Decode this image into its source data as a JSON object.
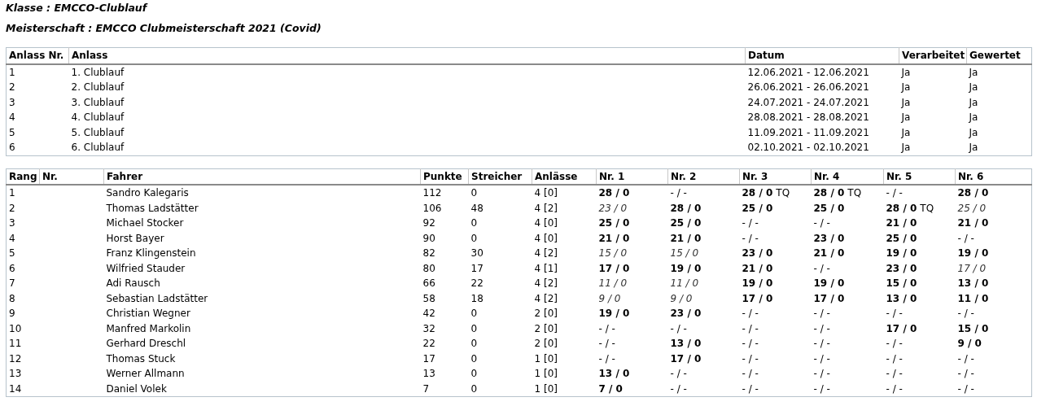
{
  "class_line": "Klasse : EMCCO-Clublauf",
  "championship_line": "Meisterschaft : EMCCO Clubmeisterschaft 2021 (Covid)",
  "events_table": {
    "columns": [
      "Anlass Nr.",
      "Anlass",
      "Datum",
      "Verarbeitet",
      "Gewertet"
    ],
    "rows": [
      [
        "1",
        "1. Clublauf",
        "12.06.2021 - 12.06.2021",
        "Ja",
        "Ja"
      ],
      [
        "2",
        "2. Clublauf",
        "26.06.2021 - 26.06.2021",
        "Ja",
        "Ja"
      ],
      [
        "3",
        "3. Clublauf",
        "24.07.2021 - 24.07.2021",
        "Ja",
        "Ja"
      ],
      [
        "4",
        "4. Clublauf",
        "28.08.2021 - 28.08.2021",
        "Ja",
        "Ja"
      ],
      [
        "5",
        "5. Clublauf",
        "11.09.2021 - 11.09.2021",
        "Ja",
        "Ja"
      ],
      [
        "6",
        "6. Clublauf",
        "02.10.2021 - 02.10.2021",
        "Ja",
        "Ja"
      ]
    ]
  },
  "ranking_table": {
    "columns": [
      "Rang",
      "Nr.",
      "Fahrer",
      "Punkte",
      "Streicher",
      "Anlässe",
      "Nr. 1",
      "Nr. 2",
      "Nr. 3",
      "Nr. 4",
      "Nr. 5",
      "Nr. 6"
    ],
    "rows": [
      {
        "rank": "1",
        "driver": "Sandro Kalegaris",
        "points": "112",
        "dropped": "0",
        "events": "4 [0]",
        "results": [
          {
            "score": "28 / 0",
            "kind": "counted"
          },
          {
            "score": "- / -",
            "kind": "empty"
          },
          {
            "score": "28 / 0",
            "kind": "counted",
            "note": "TQ"
          },
          {
            "score": "28 / 0",
            "kind": "counted",
            "note": "TQ"
          },
          {
            "score": "- / -",
            "kind": "empty"
          },
          {
            "score": "28 / 0",
            "kind": "counted"
          }
        ]
      },
      {
        "rank": "2",
        "driver": "Thomas Ladstätter",
        "points": "106",
        "dropped": "48",
        "events": "4 [2]",
        "results": [
          {
            "score": "23 / 0",
            "kind": "dropped"
          },
          {
            "score": "28 / 0",
            "kind": "counted"
          },
          {
            "score": "25 / 0",
            "kind": "counted"
          },
          {
            "score": "25 / 0",
            "kind": "counted"
          },
          {
            "score": "28 / 0",
            "kind": "counted",
            "note": "TQ"
          },
          {
            "score": "25 / 0",
            "kind": "dropped"
          }
        ]
      },
      {
        "rank": "3",
        "driver": "Michael Stocker",
        "points": "92",
        "dropped": "0",
        "events": "4 [0]",
        "results": [
          {
            "score": "25 / 0",
            "kind": "counted"
          },
          {
            "score": "25 / 0",
            "kind": "counted"
          },
          {
            "score": "- / -",
            "kind": "empty"
          },
          {
            "score": "- / -",
            "kind": "empty"
          },
          {
            "score": "21 / 0",
            "kind": "counted"
          },
          {
            "score": "21 / 0",
            "kind": "counted"
          }
        ]
      },
      {
        "rank": "4",
        "driver": "Horst Bayer",
        "points": "90",
        "dropped": "0",
        "events": "4 [0]",
        "results": [
          {
            "score": "21 / 0",
            "kind": "counted"
          },
          {
            "score": "21 / 0",
            "kind": "counted"
          },
          {
            "score": "- / -",
            "kind": "empty"
          },
          {
            "score": "23 / 0",
            "kind": "counted"
          },
          {
            "score": "25 / 0",
            "kind": "counted"
          },
          {
            "score": "- / -",
            "kind": "empty"
          }
        ]
      },
      {
        "rank": "5",
        "driver": "Franz Klingenstein",
        "points": "82",
        "dropped": "30",
        "events": "4 [2]",
        "results": [
          {
            "score": "15 / 0",
            "kind": "dropped"
          },
          {
            "score": "15 / 0",
            "kind": "dropped"
          },
          {
            "score": "23 / 0",
            "kind": "counted"
          },
          {
            "score": "21 / 0",
            "kind": "counted"
          },
          {
            "score": "19 / 0",
            "kind": "counted"
          },
          {
            "score": "19 / 0",
            "kind": "counted"
          }
        ]
      },
      {
        "rank": "6",
        "driver": "Wilfried Stauder",
        "points": "80",
        "dropped": "17",
        "events": "4 [1]",
        "results": [
          {
            "score": "17 / 0",
            "kind": "counted"
          },
          {
            "score": "19 / 0",
            "kind": "counted"
          },
          {
            "score": "21 / 0",
            "kind": "counted"
          },
          {
            "score": "- / -",
            "kind": "empty"
          },
          {
            "score": "23 / 0",
            "kind": "counted"
          },
          {
            "score": "17 / 0",
            "kind": "dropped"
          }
        ]
      },
      {
        "rank": "7",
        "driver": "Adi Rausch",
        "points": "66",
        "dropped": "22",
        "events": "4 [2]",
        "results": [
          {
            "score": "11 / 0",
            "kind": "dropped"
          },
          {
            "score": "11 / 0",
            "kind": "dropped"
          },
          {
            "score": "19 / 0",
            "kind": "counted"
          },
          {
            "score": "19 / 0",
            "kind": "counted"
          },
          {
            "score": "15 / 0",
            "kind": "counted"
          },
          {
            "score": "13 / 0",
            "kind": "counted"
          }
        ]
      },
      {
        "rank": "8",
        "driver": "Sebastian Ladstätter",
        "points": "58",
        "dropped": "18",
        "events": "4 [2]",
        "results": [
          {
            "score": "9 / 0",
            "kind": "dropped"
          },
          {
            "score": "9 / 0",
            "kind": "dropped"
          },
          {
            "score": "17 / 0",
            "kind": "counted"
          },
          {
            "score": "17 / 0",
            "kind": "counted"
          },
          {
            "score": "13 / 0",
            "kind": "counted"
          },
          {
            "score": "11 / 0",
            "kind": "counted"
          }
        ]
      },
      {
        "rank": "9",
        "driver": "Christian Wegner",
        "points": "42",
        "dropped": "0",
        "events": "2 [0]",
        "results": [
          {
            "score": "19 / 0",
            "kind": "counted"
          },
          {
            "score": "23 / 0",
            "kind": "counted"
          },
          {
            "score": "- / -",
            "kind": "empty"
          },
          {
            "score": "- / -",
            "kind": "empty"
          },
          {
            "score": "- / -",
            "kind": "empty"
          },
          {
            "score": "- / -",
            "kind": "empty"
          }
        ]
      },
      {
        "rank": "10",
        "driver": "Manfred Markolin",
        "points": "32",
        "dropped": "0",
        "events": "2 [0]",
        "results": [
          {
            "score": "- / -",
            "kind": "empty"
          },
          {
            "score": "- / -",
            "kind": "empty"
          },
          {
            "score": "- / -",
            "kind": "empty"
          },
          {
            "score": "- / -",
            "kind": "empty"
          },
          {
            "score": "17 / 0",
            "kind": "counted"
          },
          {
            "score": "15 / 0",
            "kind": "counted"
          }
        ]
      },
      {
        "rank": "11",
        "driver": "Gerhard Dreschl",
        "points": "22",
        "dropped": "0",
        "events": "2 [0]",
        "results": [
          {
            "score": "- / -",
            "kind": "empty"
          },
          {
            "score": "13 / 0",
            "kind": "counted"
          },
          {
            "score": "- / -",
            "kind": "empty"
          },
          {
            "score": "- / -",
            "kind": "empty"
          },
          {
            "score": "- / -",
            "kind": "empty"
          },
          {
            "score": "9 / 0",
            "kind": "counted"
          }
        ]
      },
      {
        "rank": "12",
        "driver": "Thomas Stuck",
        "points": "17",
        "dropped": "0",
        "events": "1 [0]",
        "results": [
          {
            "score": "- / -",
            "kind": "empty"
          },
          {
            "score": "17 / 0",
            "kind": "counted"
          },
          {
            "score": "- / -",
            "kind": "empty"
          },
          {
            "score": "- / -",
            "kind": "empty"
          },
          {
            "score": "- / -",
            "kind": "empty"
          },
          {
            "score": "- / -",
            "kind": "empty"
          }
        ]
      },
      {
        "rank": "13",
        "driver": "Werner Allmann",
        "points": "13",
        "dropped": "0",
        "events": "1 [0]",
        "results": [
          {
            "score": "13 / 0",
            "kind": "counted"
          },
          {
            "score": "- / -",
            "kind": "empty"
          },
          {
            "score": "- / -",
            "kind": "empty"
          },
          {
            "score": "- / -",
            "kind": "empty"
          },
          {
            "score": "- / -",
            "kind": "empty"
          },
          {
            "score": "- / -",
            "kind": "empty"
          }
        ]
      },
      {
        "rank": "14",
        "driver": "Daniel Volek",
        "points": "7",
        "dropped": "0",
        "events": "1 [0]",
        "results": [
          {
            "score": "7 / 0",
            "kind": "counted"
          },
          {
            "score": "- / -",
            "kind": "empty"
          },
          {
            "score": "- / -",
            "kind": "empty"
          },
          {
            "score": "- / -",
            "kind": "empty"
          },
          {
            "score": "- / -",
            "kind": "empty"
          },
          {
            "score": "- / -",
            "kind": "empty"
          }
        ]
      }
    ]
  }
}
